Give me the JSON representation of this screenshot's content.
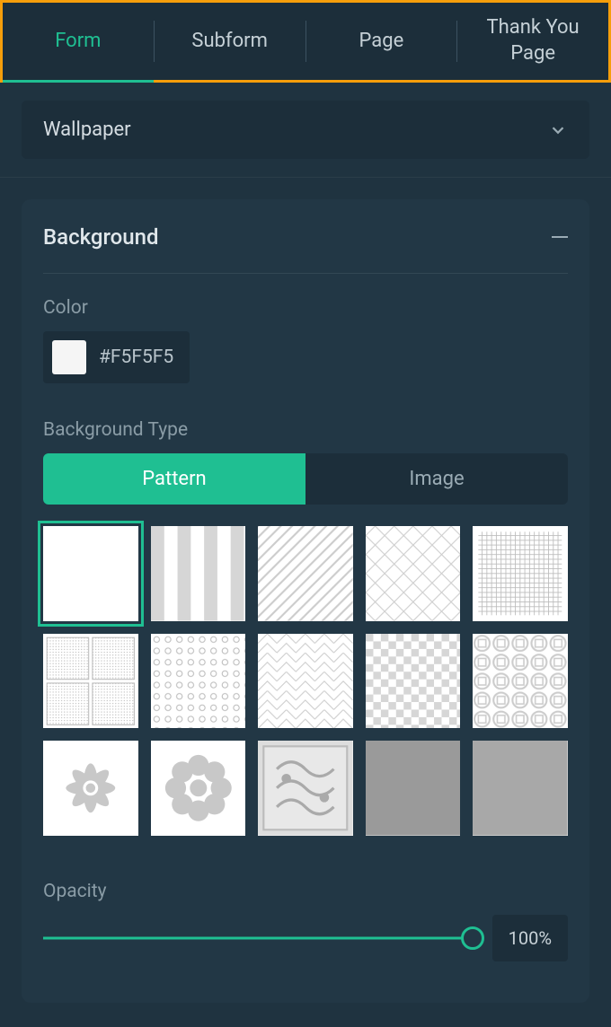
{
  "tabs": [
    {
      "label": "Form",
      "active": true
    },
    {
      "label": "Subform",
      "active": false
    },
    {
      "label": "Page",
      "active": false
    },
    {
      "label": "Thank You Page",
      "active": false
    }
  ],
  "dropdown": {
    "label": "Wallpaper"
  },
  "panel": {
    "title": "Background",
    "color_label": "Color",
    "color_value": "#F5F5F5",
    "bg_type_label": "Background Type",
    "bg_type_options": [
      "Pattern",
      "Image"
    ],
    "bg_type_selected": "Pattern",
    "patterns": [
      {
        "id": "solid",
        "selected": true
      },
      {
        "id": "stripes-vertical"
      },
      {
        "id": "diagonal-lines"
      },
      {
        "id": "diamond-lattice"
      },
      {
        "id": "grid-small"
      },
      {
        "id": "grid-quad"
      },
      {
        "id": "dots-circles"
      },
      {
        "id": "herringbone"
      },
      {
        "id": "checker"
      },
      {
        "id": "rings"
      },
      {
        "id": "flower-sharp"
      },
      {
        "id": "flower-round"
      },
      {
        "id": "ornate"
      },
      {
        "id": "texture-dark"
      },
      {
        "id": "texture-gray"
      }
    ],
    "opacity_label": "Opacity",
    "opacity_value": "100%"
  }
}
